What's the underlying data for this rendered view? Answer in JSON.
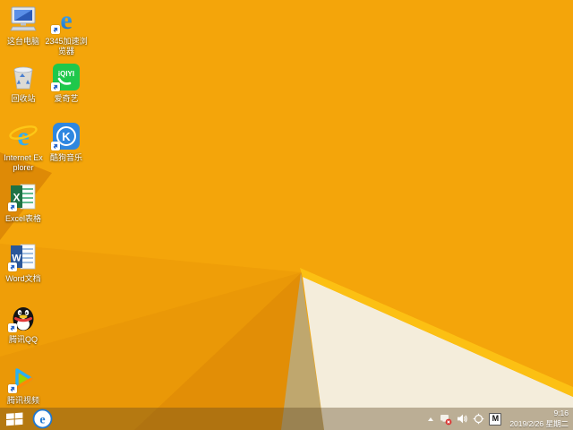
{
  "desktop": {
    "icons": [
      {
        "label": "这台电脑"
      },
      {
        "label": "2345加速浏览器"
      },
      {
        "label": "回收站"
      },
      {
        "label": "爱奇艺"
      },
      {
        "label": "Internet Explorer"
      },
      {
        "label": "酷狗音乐"
      },
      {
        "label": "Excel表格"
      },
      {
        "label": "Word文档"
      },
      {
        "label": "腾讯QQ"
      },
      {
        "label": "腾讯视频"
      }
    ]
  },
  "branding": {
    "browser_letter": "e",
    "iqiyi_text": "iQIYI",
    "ie_letter": "e",
    "kugou_letter": "K",
    "excel_letter": "X",
    "word_letter": "W"
  },
  "taskbar": {
    "tray_icon_names": [
      "hidden-icons-chevron",
      "network-error",
      "volume",
      "crosshair-utility",
      "ime-mode"
    ],
    "ime_indicator": "M",
    "clock": {
      "time": "9:16",
      "date": "2019/2/26 星期二"
    }
  },
  "colors": {
    "wallpaper_base": "#F4A50A",
    "wallpaper_shade1": "#EF9E08",
    "wallpaper_shade2": "#EA9807",
    "wallpaper_shade3": "#E28E06",
    "wallpaper_left_fold": "#DE8A06",
    "wallpaper_edge_highlight": "#FCC013",
    "wallpaper_cream": "#F4EDDB",
    "wallpaper_tan": "#BFA76E",
    "iqiyi_green": "#1FC84B",
    "kugou_blue": "#2E87E0",
    "excel_green": "#1F7244",
    "word_blue": "#2B579A",
    "qq_scarf_red": "#E23B3B",
    "ie_blue": "#35AEF0",
    "ie_swoosh_yellow": "#FDC716",
    "tray_error_red": "#D8322F"
  }
}
